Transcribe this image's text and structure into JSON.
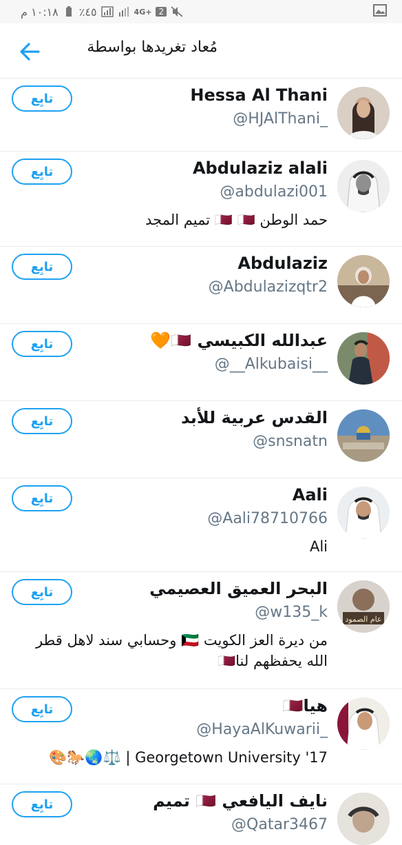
{
  "status_bar": {
    "time": "١٠:١٨ م",
    "battery": "٪٤٥",
    "network": "4G+",
    "sim": "2"
  },
  "header": {
    "title": "مُعاد تغريدها بواسطة"
  },
  "follow_label": "تابِع",
  "users": [
    {
      "name": "Hessa Al Thani",
      "handle": "@HJAlThani_",
      "bio": ""
    },
    {
      "name": "Abdulaziz alali",
      "handle": "@abdulazi001",
      "bio": "حمد الوطن 🇶🇦 🇶🇦 تميم المجد"
    },
    {
      "name": "Abdulaziz",
      "handle": "@Abdulazizqtr2",
      "bio": ""
    },
    {
      "name": "عبدالله الكبيسي 🇶🇦🧡",
      "handle": "@__Alkubaisi__",
      "bio": ""
    },
    {
      "name": "القدس عربية للأبد",
      "handle": "@snsnatn",
      "bio": ""
    },
    {
      "name": "Aali",
      "handle": "@Aali78710766",
      "bio": "Ali"
    },
    {
      "name": "البحر العميق العصيمي",
      "handle": "@w135_k",
      "bio": "من ديرة العز الكويت 🇰🇼 وحسابي سند لاهل قطر الله يحفظهم لنا🇶🇦"
    },
    {
      "name": "هيا🇶🇦",
      "handle": "@HayaAlKuwarii_",
      "bio": "Georgetown University '17 | ⚖️🌏🐎🎨"
    },
    {
      "name": "نايف اليافعي 🇶🇦 تميم",
      "handle": "@Qatar3467",
      "bio": ""
    }
  ]
}
